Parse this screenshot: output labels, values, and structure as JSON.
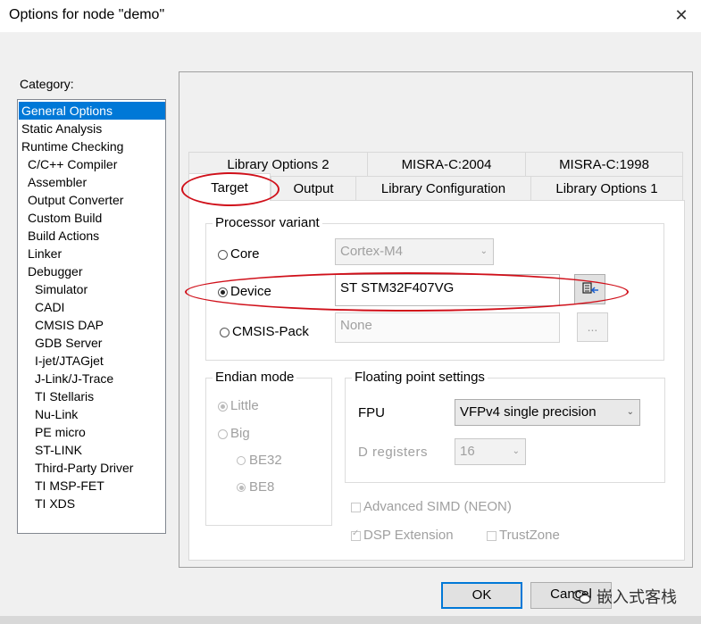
{
  "window": {
    "title": "Options for node \"demo\"",
    "close_glyph": "✕"
  },
  "category": {
    "label": "Category:",
    "items": [
      "General Options",
      "Static Analysis",
      "Runtime Checking",
      "C/C++ Compiler",
      "Assembler",
      "Output Converter",
      "Custom Build",
      "Build Actions",
      "Linker",
      "Debugger",
      "Simulator",
      "CADI",
      "CMSIS DAP",
      "GDB Server",
      "I-jet/JTAGjet",
      "J-Link/J-Trace",
      "TI Stellaris",
      "Nu-Link",
      "PE micro",
      "ST-LINK",
      "Third-Party Driver",
      "TI MSP-FET",
      "TI XDS"
    ],
    "selected": "General Options"
  },
  "tabs": {
    "row1": [
      "Library Options 2",
      "MISRA-C:2004",
      "MISRA-C:1998"
    ],
    "row2": [
      "Target",
      "Output",
      "Library Configuration",
      "Library Options 1"
    ],
    "active": "Target"
  },
  "processor_variant": {
    "label": "Processor variant",
    "core_label": "Core",
    "core_value": "Cortex-M4",
    "device_label": "Device",
    "device_value": "ST STM32F407VG",
    "cmsis_label": "CMSIS-Pack",
    "cmsis_value": "None",
    "cmsis_button": "...",
    "selected": "Device",
    "device_button_icon": "select-device-icon"
  },
  "endian": {
    "label": "Endian mode",
    "little": "Little",
    "big": "Big",
    "be32": "BE32",
    "be8": "BE8"
  },
  "floating_point": {
    "label": "Floating point settings",
    "fpu_label": "FPU",
    "fpu_value": "VFPv4 single precision",
    "dregs_label": "D registers",
    "dregs_value": "16"
  },
  "checkboxes": {
    "advanced_simd": "Advanced SIMD (NEON)",
    "dsp_extension": "DSP Extension",
    "trustzone": "TrustZone"
  },
  "buttons": {
    "ok": "OK",
    "cancel": "Cancel"
  },
  "watermark": "嵌入式客栈",
  "colors": {
    "selection": "#0078d7",
    "annotation": "#d0101a"
  }
}
